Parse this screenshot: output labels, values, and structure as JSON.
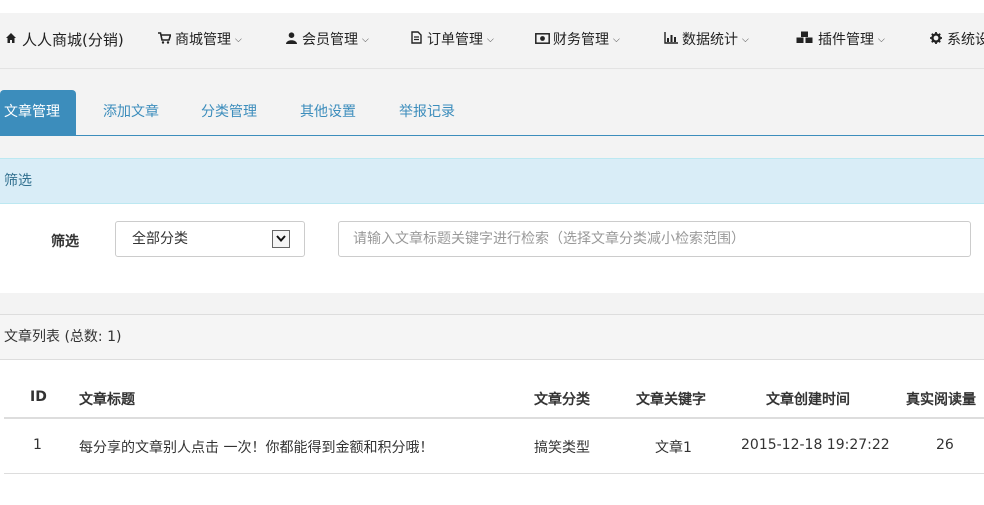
{
  "nav": {
    "brand": "人人商城(分销)",
    "items": [
      {
        "label": "商城管理",
        "icon": "cart-icon"
      },
      {
        "label": "会员管理",
        "icon": "user-icon"
      },
      {
        "label": "订单管理",
        "icon": "document-icon"
      },
      {
        "label": "财务管理",
        "icon": "money-icon"
      },
      {
        "label": "数据统计",
        "icon": "bar-chart-icon"
      },
      {
        "label": "插件管理",
        "icon": "cubes-icon"
      },
      {
        "label": "系统设",
        "icon": "gear-icon"
      }
    ]
  },
  "tabs": [
    "文章管理",
    "添加文章",
    "分类管理",
    "其他设置",
    "举报记录"
  ],
  "filter": {
    "panel_title": "筛选",
    "label": "筛选",
    "category_value": "全部分类",
    "search_placeholder": "请输入文章标题关键字进行检索（选择文章分类减小检索范围）"
  },
  "list": {
    "title": "文章列表 (总数: 1)",
    "columns": [
      "ID",
      "文章标题",
      "文章分类",
      "文章关键字",
      "文章创建时间",
      "真实阅读量"
    ],
    "rows": [
      {
        "id": "1",
        "title": "每分享的文章别人点击 一次！你都能得到金额和积分哦！",
        "category": "搞笑类型",
        "keyword": "文章1",
        "created": "2015-12-18 19:27:22",
        "reads": "26"
      }
    ]
  },
  "colors": {
    "accent": "#3c8dbc",
    "panel_head_bg": "#d9edf7"
  }
}
